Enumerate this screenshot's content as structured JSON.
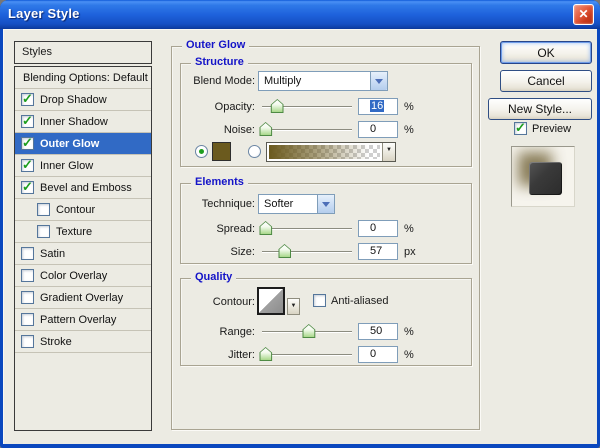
{
  "window": {
    "title": "Layer Style",
    "close_glyph": "✕"
  },
  "colors": {
    "selection_blue": "#316AC5",
    "glow_swatch": "#6B5A1E",
    "check_green": "#1E9E1E"
  },
  "sidebar": {
    "header": "Styles",
    "items": [
      {
        "label": "Blending Options: Default",
        "checkbox": false,
        "checked": false,
        "indent": false,
        "selected": false
      },
      {
        "label": "Drop Shadow",
        "checkbox": true,
        "checked": true,
        "indent": false,
        "selected": false
      },
      {
        "label": "Inner Shadow",
        "checkbox": true,
        "checked": true,
        "indent": false,
        "selected": false
      },
      {
        "label": "Outer Glow",
        "checkbox": true,
        "checked": true,
        "indent": false,
        "selected": true
      },
      {
        "label": "Inner Glow",
        "checkbox": true,
        "checked": true,
        "indent": false,
        "selected": false
      },
      {
        "label": "Bevel and Emboss",
        "checkbox": true,
        "checked": true,
        "indent": false,
        "selected": false
      },
      {
        "label": "Contour",
        "checkbox": true,
        "checked": false,
        "indent": true,
        "selected": false
      },
      {
        "label": "Texture",
        "checkbox": true,
        "checked": false,
        "indent": true,
        "selected": false
      },
      {
        "label": "Satin",
        "checkbox": true,
        "checked": false,
        "indent": false,
        "selected": false
      },
      {
        "label": "Color Overlay",
        "checkbox": true,
        "checked": false,
        "indent": false,
        "selected": false
      },
      {
        "label": "Gradient Overlay",
        "checkbox": true,
        "checked": false,
        "indent": false,
        "selected": false
      },
      {
        "label": "Pattern Overlay",
        "checkbox": true,
        "checked": false,
        "indent": false,
        "selected": false
      },
      {
        "label": "Stroke",
        "checkbox": true,
        "checked": false,
        "indent": false,
        "selected": false
      }
    ]
  },
  "panel": {
    "title": "Outer Glow",
    "structure": {
      "title": "Structure",
      "blend_mode_label": "Blend Mode:",
      "blend_mode_value": "Multiply",
      "opacity_label": "Opacity:",
      "opacity_value": "16",
      "opacity_unit": "%",
      "opacity_pct": 17,
      "noise_label": "Noise:",
      "noise_value": "0",
      "noise_unit": "%",
      "noise_pct": 4,
      "color_radio_selected": true,
      "gradient_radio_selected": false
    },
    "elements": {
      "title": "Elements",
      "technique_label": "Technique:",
      "technique_value": "Softer",
      "spread_label": "Spread:",
      "spread_value": "0",
      "spread_unit": "%",
      "spread_pct": 4,
      "size_label": "Size:",
      "size_value": "57",
      "size_unit": "px",
      "size_pct": 25
    },
    "quality": {
      "title": "Quality",
      "contour_label": "Contour:",
      "anti_aliased_label": "Anti-aliased",
      "anti_aliased_checked": false,
      "range_label": "Range:",
      "range_value": "50",
      "range_unit": "%",
      "range_pct": 52,
      "jitter_label": "Jitter:",
      "jitter_value": "0",
      "jitter_unit": "%",
      "jitter_pct": 4
    }
  },
  "actions": {
    "ok": "OK",
    "cancel": "Cancel",
    "new_style": "New Style...",
    "preview": "Preview",
    "preview_checked": true
  }
}
